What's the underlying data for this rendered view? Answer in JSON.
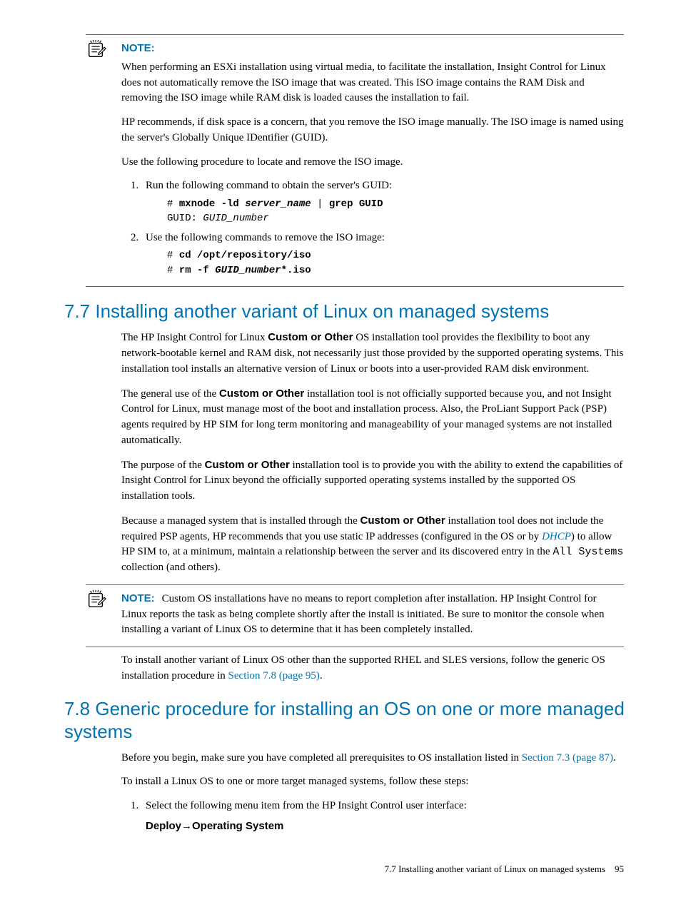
{
  "note1": {
    "label": "NOTE:",
    "p1a": "When performing an ESXi installation using virtual media, to facilitate the installation, Insight Control for Linux does not automatically remove the ISO image that was created. This ISO image contains the RAM Disk and removing the ISO image while RAM disk is loaded causes the installation to fail.",
    "p1b": "HP recommends, if disk space is a concern, that you remove the ISO image manually. The ISO image is named using the server's Globally Unique IDentifier (GUID).",
    "p1c": "Use the following procedure to locate and remove the ISO image.",
    "li1": "Run the following command to obtain the server's GUID:",
    "code1a": "# ",
    "code1b": "mxnode -ld ",
    "code1c": "server_name",
    "code1d": " | ",
    "code1e": "grep GUID",
    "code1f": "GUID: ",
    "code1g": "GUID_number",
    "li2": "Use the following commands to remove the ISO image:",
    "code2a": "# ",
    "code2b": "cd /opt/repository/iso",
    "code2c": "# ",
    "code2d": "rm -f ",
    "code2e": "GUID_number",
    "code2f": "*.iso"
  },
  "s77": {
    "heading": "7.7 Installing another variant of Linux on managed systems",
    "p1a": "The HP Insight Control for Linux ",
    "p1b": "Custom or Other",
    "p1c": " OS installation tool provides the flexibility to boot any network-bootable kernel and RAM disk, not necessarily just those provided by the supported operating systems. This installation tool installs an alternative version of Linux or boots into a user-provided RAM disk environment.",
    "p2a": "The general use of the ",
    "p2b": "Custom or Other",
    "p2c": " installation tool is not officially supported because you, and not Insight Control for Linux, must manage most of the boot and installation process. Also, the ProLiant Support Pack (PSP) agents required by HP SIM for long term monitoring and manageability of your managed systems are not installed automatically.",
    "p3a": "The purpose of the ",
    "p3b": "Custom or Other",
    "p3c": " installation tool is to provide you with the ability to extend the capabilities of Insight Control for Linux beyond the officially supported operating systems installed by the supported OS installation tools.",
    "p4a": "Because a managed system that is installed through the ",
    "p4b": "Custom or Other",
    "p4c": " installation tool does not include the required PSP agents, HP recommends that you use static IP addresses (configured in the OS or by ",
    "p4d": "DHCP",
    "p4e": ") to allow HP SIM to, at a minimum, maintain a relationship between the server and its discovered entry in the ",
    "p4f": "All Systems",
    "p4g": " collection (and others)."
  },
  "note2": {
    "label": "NOTE:",
    "text": "Custom OS installations have no means to report completion after installation. HP Insight Control for Linux reports the task as being complete shortly after the install is initiated. Be sure to monitor the console when installing a variant of Linux OS to determine that it has been completely installed."
  },
  "s77tail": {
    "p1a": "To install another variant of Linux OS other than the supported RHEL and SLES versions, follow the generic OS installation procedure in ",
    "p1b": "Section 7.8 (page 95)",
    "p1c": "."
  },
  "s78": {
    "heading": "7.8 Generic procedure for installing an OS on one or more managed systems",
    "p1a": "Before you begin, make sure you have completed all prerequisites to OS installation listed in ",
    "p1b": "Section 7.3 (page 87)",
    "p1c": ".",
    "p2": "To install a Linux OS to one or more target managed systems, follow these steps:",
    "li1": "Select the following menu item from the HP Insight Control user interface:",
    "menu": "Deploy→Operating System"
  },
  "footer": {
    "text": "7.7 Installing another variant of Linux on managed systems",
    "page": "95"
  }
}
